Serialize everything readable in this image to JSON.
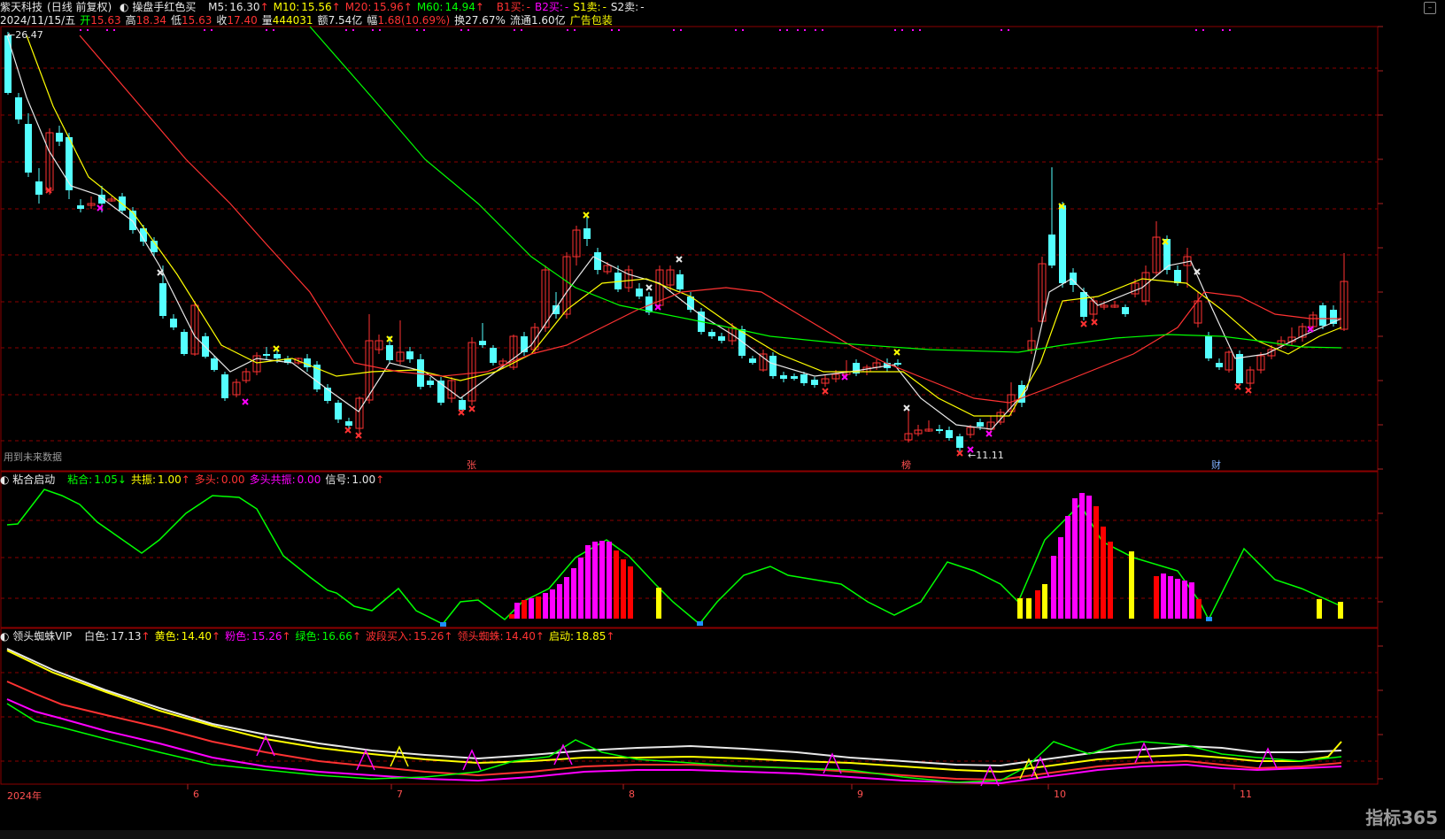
{
  "header": {
    "stock": "紫天科技",
    "period": "(日线 前复权)",
    "indicator": "操盘手红色买",
    "ma": [
      {
        "label": "M5:",
        "value": "16.30",
        "arrow": "↑",
        "color": "#e8e8e8"
      },
      {
        "label": "M10:",
        "value": "15.56",
        "arrow": "↑",
        "color": "#ffff00"
      },
      {
        "label": "M20:",
        "value": "15.96",
        "arrow": "↑",
        "color": "#ff3232"
      },
      {
        "label": "M60:",
        "value": "14.94",
        "arrow": "↑",
        "color": "#00ff00"
      }
    ],
    "signals": [
      {
        "label": "B1买:",
        "value": "-",
        "color": "#ff3232"
      },
      {
        "label": "B2买:",
        "value": "-",
        "color": "#ff00ff"
      },
      {
        "label": "S1卖:",
        "value": "-",
        "color": "#ffff00"
      },
      {
        "label": "S2卖:",
        "value": "-",
        "color": "#e8e8e8"
      }
    ]
  },
  "quote": {
    "date": "2024/11/15/五",
    "open_label": "开",
    "open": "15.63",
    "high_label": "高",
    "high": "18.34",
    "low_label": "低",
    "low": "15.63",
    "close_label": "收",
    "close": "17.40",
    "vol_label": "量",
    "vol": "444031",
    "amount_label": "额",
    "amount": "7.54亿",
    "change_label": "幅",
    "change": "1.68(10.69%)",
    "turnover_label": "换",
    "turnover": "27.67%",
    "float_label": "流通",
    "float": "1.60亿",
    "ad": "广告包装"
  },
  "price_panel": {
    "high_marker": "26.47",
    "low_marker": "11.11",
    "future_note": "用到未来数据",
    "badges": [
      "张",
      "榜",
      "财"
    ]
  },
  "panel2": {
    "name": "粘合启动",
    "items": [
      {
        "label": "粘合:",
        "value": "1.05",
        "arrow": "↓",
        "color": "#00ff00"
      },
      {
        "label": "共振:",
        "value": "1.00",
        "arrow": "↑",
        "color": "#ffff00"
      },
      {
        "label": "多头:",
        "value": "0.00",
        "arrow": "",
        "color": "#ff3232"
      },
      {
        "label": "多头共振:",
        "value": "0.00",
        "arrow": "",
        "color": "#ff00ff"
      },
      {
        "label": "信号:",
        "value": "1.00",
        "arrow": "↑",
        "color": "#e8e8e8"
      }
    ]
  },
  "panel3": {
    "name": "领头蜘蛛VIP",
    "items": [
      {
        "label": "白色:",
        "value": "17.13",
        "arrow": "↑",
        "color": "#e8e8e8"
      },
      {
        "label": "黄色:",
        "value": "14.40",
        "arrow": "↑",
        "color": "#ffff00"
      },
      {
        "label": "粉色:",
        "value": "15.26",
        "arrow": "↑",
        "color": "#ff00ff"
      },
      {
        "label": "绿色:",
        "value": "16.66",
        "arrow": "↑",
        "color": "#00ff00"
      },
      {
        "label": "波段买入:",
        "value": "15.26",
        "arrow": "↑",
        "color": "#ff3232"
      },
      {
        "label": "领头蜘蛛:",
        "value": "14.40",
        "arrow": "↑",
        "color": "#ff3232"
      },
      {
        "label": "启动:",
        "value": "18.85",
        "arrow": "↑",
        "color": "#ffff00"
      }
    ]
  },
  "xaxis": {
    "labels": [
      "2024年",
      "6",
      "7",
      "8",
      "9",
      "10",
      "11"
    ]
  },
  "logo": "指标365",
  "colors": {
    "up": "#ff3232",
    "down": "#54ffff",
    "ma5": "#e8e8e8",
    "ma10": "#ffff00",
    "ma20": "#ff3232",
    "ma60": "#00ff00",
    "grid": "#8b0000"
  }
}
